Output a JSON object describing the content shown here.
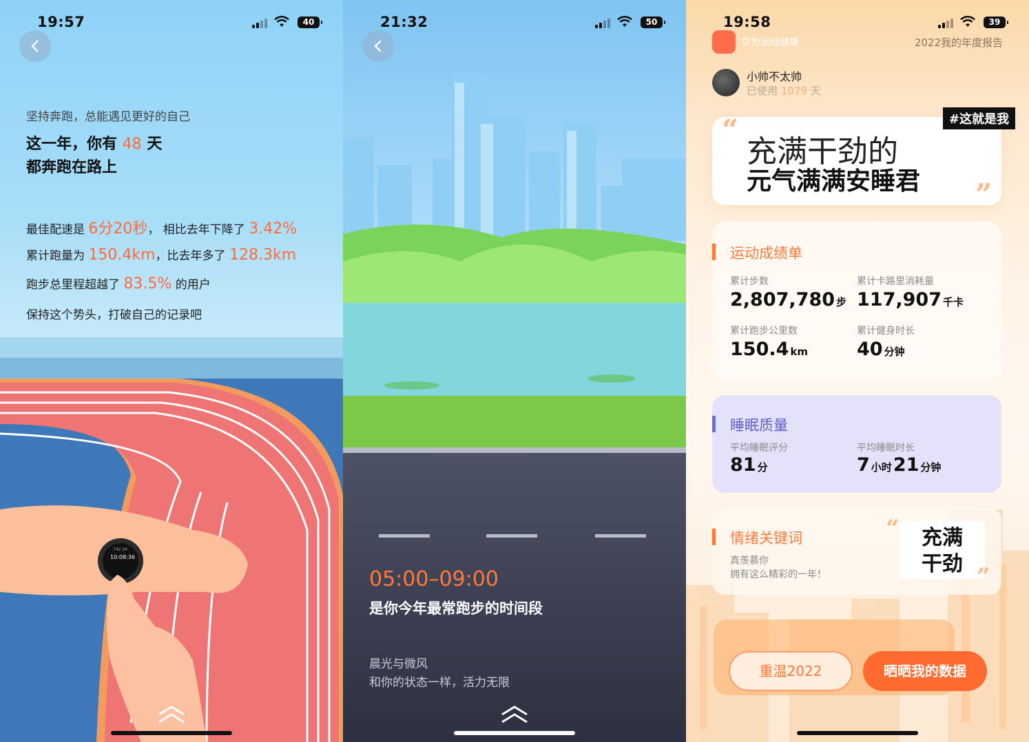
{
  "panel1": {
    "status": {
      "time": "19:57",
      "battery": "40"
    },
    "intro": "坚持奔跑，总能遇见更好的自己",
    "headline_a": "这一年，你有 ",
    "headline_days": "48",
    "headline_b": " 天",
    "headline_line2": "都奔跑在路上",
    "pace_prefix": "最佳配速是 ",
    "pace_value": "6分20秒",
    "pace_mid": "， 相比去年下降了 ",
    "pace_drop": "3.42%",
    "dist_prefix": "累计跑量为 ",
    "dist_value": "150.4km",
    "dist_mid": "，比去年多了 ",
    "dist_more": "128.3km",
    "rank_prefix": "跑步总里程超越了 ",
    "rank_value": "83.5%",
    "rank_suffix": " 的用户",
    "motto": "保持这个势头，打破自己的记录吧",
    "watch_text_1": "10:08:36",
    "watch_text_2": "742  24"
  },
  "panel2": {
    "status": {
      "time": "21:32",
      "battery": "50"
    },
    "time_range": "05:00–09:00",
    "caption": "是你今年最常跑步的时间段",
    "sub1": "晨光与微风",
    "sub2": "和你的状态一样，活力无限"
  },
  "panel3": {
    "status": {
      "time": "19:58",
      "battery": "39"
    },
    "brand": "华为运动健康",
    "report": "2022我的年度报告",
    "username": "小帅不太帅",
    "used_prefix": "已使用 ",
    "used_days": "1079",
    "used_suffix": " 天",
    "tag": "#这就是我",
    "quote_line1": "充满干劲的",
    "quote_line2": "元气满满安睡君",
    "sports": {
      "title": "运动成绩单",
      "steps_label": "累计步数",
      "steps_value": "2,807,780",
      "steps_unit": "步",
      "cal_label": "累计卡路里消耗量",
      "cal_value": "117,907",
      "cal_unit": "千卡",
      "run_label": "累计跑步公里数",
      "run_value": "150.4",
      "run_unit": "km",
      "fit_label": "累计健身时长",
      "fit_value": "40",
      "fit_unit": "分钟"
    },
    "sleep": {
      "title": "睡眠质量",
      "score_label": "平均睡眠评分",
      "score_value": "81",
      "score_unit": "分",
      "dur_label": "平均睡眠时长",
      "dur_h": "7",
      "dur_h_unit": "小时",
      "dur_m": "21",
      "dur_m_unit": "分钟"
    },
    "mood": {
      "title": "情绪关键词",
      "line1": "真羡慕你",
      "line2": "拥有这么精彩的一年！",
      "keyword_1": "充满",
      "keyword_2": "干劲"
    },
    "btn_replay": "重温2022",
    "btn_share": "晒晒我的数据"
  },
  "colors": {
    "accent": "#ff6a3d",
    "sleep_bar": "#6a6fd8",
    "share_btn": "#ff6a2e"
  },
  "icons": [
    "back-arrow-icon",
    "signal-icon",
    "wifi-icon",
    "battery-icon",
    "swipe-up-icon",
    "app-logo-icon",
    "quote-icon"
  ]
}
